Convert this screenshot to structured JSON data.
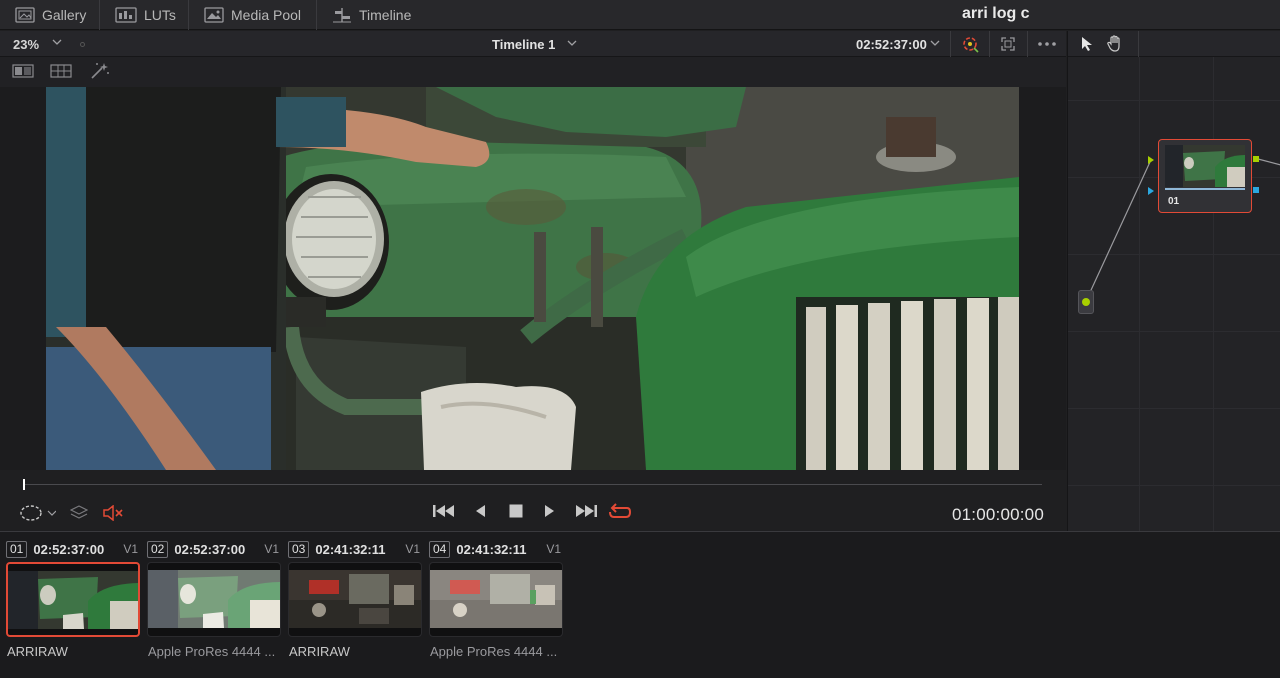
{
  "topbar": {
    "tabs": [
      {
        "label": "Gallery",
        "icon": "gallery-icon"
      },
      {
        "label": "LUTs",
        "icon": "luts-icon"
      },
      {
        "label": "Media Pool",
        "icon": "media-pool-icon"
      },
      {
        "label": "Timeline",
        "icon": "timeline-icon"
      }
    ],
    "project_title": "arri log c"
  },
  "viewer": {
    "zoom": "23%",
    "timeline_name": "Timeline 1",
    "timecode": "02:52:37:00",
    "playback_timecode": "01:00:00:00"
  },
  "nodes": {
    "node_label": "01"
  },
  "clips": [
    {
      "number": "01",
      "timecode": "02:52:37:00",
      "track": "V1",
      "codec": "ARRIRAW",
      "selected": true
    },
    {
      "number": "02",
      "timecode": "02:52:37:00",
      "track": "V1",
      "codec": "Apple ProRes 4444 ...",
      "selected": false
    },
    {
      "number": "03",
      "timecode": "02:41:32:11",
      "track": "V1",
      "codec": "ARRIRAW",
      "selected": false
    },
    {
      "number": "04",
      "timecode": "02:41:32:11",
      "track": "V1",
      "codec": "Apple ProRes 4444 ...",
      "selected": false
    }
  ],
  "colors": {
    "accent_red": "#e24a36",
    "node_green": "#a8d000",
    "node_blue": "#2ba8e0"
  }
}
